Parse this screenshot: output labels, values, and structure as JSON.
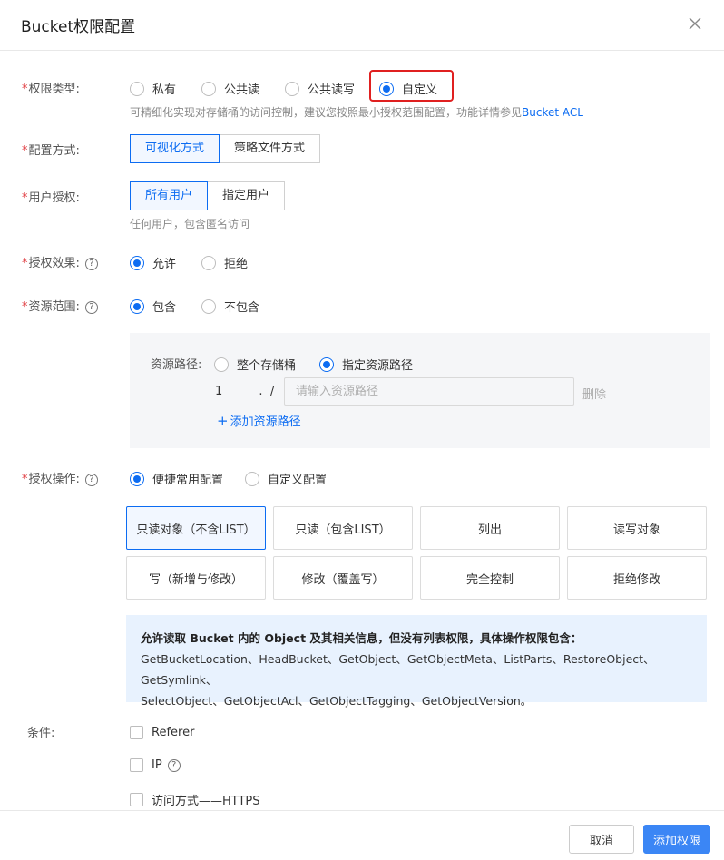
{
  "dialog": {
    "title": "Bucket权限配置"
  },
  "permission_type": {
    "label": "权限类型:",
    "options": [
      "私有",
      "公共读",
      "公共读写",
      "自定义"
    ],
    "selected": "自定义",
    "hint": "可精细化实现对存储桶的访问控制，建议您按照最小授权范围配置，功能详情参见",
    "hint_link": "Bucket ACL"
  },
  "config_mode": {
    "label": "配置方式:",
    "options": [
      "可视化方式",
      "策略文件方式"
    ],
    "selected": "可视化方式"
  },
  "user_auth": {
    "label": "用户授权:",
    "options": [
      "所有用户",
      "指定用户"
    ],
    "selected": "所有用户",
    "hint": "任何用户，包含匿名访问"
  },
  "effect": {
    "label": "授权效果:",
    "help": "?",
    "options": [
      "允许",
      "拒绝"
    ],
    "selected": "允许"
  },
  "resource_scope": {
    "label": "资源范围:",
    "help": "?",
    "options": [
      "包含",
      "不包含"
    ],
    "selected": "包含"
  },
  "resource_path": {
    "label": "资源路径:",
    "options": [
      "整个存储桶",
      "指定资源路径"
    ],
    "selected": "指定资源路径",
    "bucket_prefix": "1",
    "bucket_suffix": "․",
    "separator": "/",
    "placeholder": "请输入资源路径",
    "delete": "删除",
    "add": "添加资源路径"
  },
  "actions": {
    "label": "授权操作:",
    "help": "?",
    "modes": [
      "便捷常用配置",
      "自定义配置"
    ],
    "selected_mode": "便捷常用配置",
    "presets": [
      "只读对象（不含LIST）",
      "只读（包含LIST）",
      "列出",
      "读写对象",
      "写（新增与修改）",
      "修改（覆盖写）",
      "完全控制",
      "拒绝修改"
    ],
    "selected_preset": "只读对象（不含LIST）",
    "info_title": "允许读取 Bucket 内的 Object 及其相关信息，但没有列表权限，具体操作权限包含：",
    "info_line1": "GetBucketLocation、HeadBucket、GetObject、GetObjectMeta、ListParts、RestoreObject、GetSymlink、",
    "info_line2": "SelectObject、GetObjectAcl、GetObjectTagging、GetObjectVersion。"
  },
  "conditions": {
    "label": "条件:",
    "items": [
      "Referer",
      "IP",
      "访问方式——HTTPS"
    ],
    "ip_help": "?"
  },
  "footer": {
    "cancel": "取消",
    "submit": "添加权限"
  },
  "colors": {
    "primary": "#0c6cf2",
    "required": "#e0393e",
    "highlight": "#e02020",
    "info_bg": "#e8f2fe"
  },
  "icons": {
    "close": "close-icon",
    "help": "help-circle-icon",
    "add": "plus-icon"
  }
}
